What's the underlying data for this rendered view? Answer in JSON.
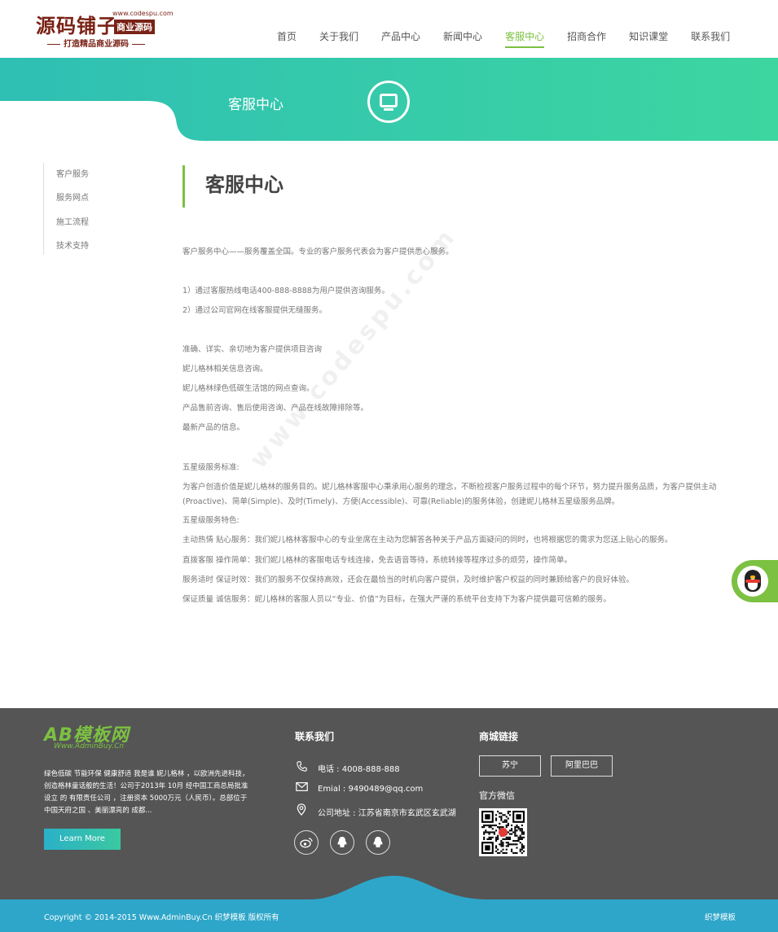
{
  "header": {
    "logo_main": "源码铺子",
    "logo_url": "www.codespu.com",
    "logo_badge": "商业源码",
    "logo_slogan": "打造精品商业源码",
    "nav": [
      {
        "label": "首页"
      },
      {
        "label": "关于我们"
      },
      {
        "label": "产品中心"
      },
      {
        "label": "新闻中心"
      },
      {
        "label": "客服中心"
      },
      {
        "label": "招商合作"
      },
      {
        "label": "知识课堂"
      },
      {
        "label": "联系我们"
      }
    ],
    "active_nav": "客服中心",
    "accent_color": "#7cc142"
  },
  "banner": {
    "title": "客服中心",
    "icon": "monitor-icon",
    "gradient": [
      "#2fbfb4",
      "#3dd6a0"
    ]
  },
  "sidebar": {
    "items": [
      {
        "label": "客户服务"
      },
      {
        "label": "服务网点"
      },
      {
        "label": "施工流程"
      },
      {
        "label": "技术支持"
      }
    ]
  },
  "content": {
    "title": "客服中心",
    "p1": "客户服务中心——服务覆盖全国。专业的客户服务代表会为客户提供悉心服务。",
    "p2": "1）通过客服热线电话400-888-8888为用户提供咨询服务。",
    "p3": "2）通过公司官网在线客服提供无缝服务。",
    "p4": "准确、详实、亲切地为客户提供项目咨询",
    "p5": "妮儿格林相关信息咨询。",
    "p6": "妮儿格林绿色低碳生活馆的网点查询。",
    "p7": "产品售前咨询、售后使用咨询、产品在线故障排除等。",
    "p8": "最新产品的信息。",
    "p9": "五星级服务标准:",
    "p10": "为客户创造价值是妮儿格林的服务目的。妮儿格林客服中心秉承用心服务的理念，不断检视客户服务过程中的每个环节，努力提升服务品质，为客户提供主动(Proactive)、简单(Simple)、及时(Timely)、方便(Accessible)、可靠(Reliable)的服务体验，创建妮儿格林五星级服务品牌。",
    "p11": "五星级服务特色:",
    "p12": "主动热情 贴心服务：我们妮儿格林客服中心的专业坐席在主动为您解答各种关于产品方面疑问的同时，也将根据您的需求为您送上贴心的服务。",
    "p13": "直拨客服 操作简单：我们妮儿格林的客服电话专线连接，免去语音等待，系统转接等程序过多的烦劳，操作简单。",
    "p14": "服务适时 保证时效：我们的服务不仅保持高效，还会在最恰当的时机向客户提供，及时维护客户权益的同时兼顾给客户的良好体验。",
    "p15": "保证质量 诚信服务：妮儿格林的客服人员以“专业、价值”为目标，在强大严谨的系统平台支持下为客户提供最可信赖的服务。",
    "watermark": "www.codespu.com"
  },
  "float": {
    "icon": "qq-penguin-icon"
  },
  "footer": {
    "logo": "AB模板网",
    "logo_sub": "Www.AdminBuy.Cn",
    "intro": "绿色低碳 节能环保 健康舒适 我是谁 妮儿格林 ，以欧洲先进科技，创造格林童话般的生活！公司于2013年 10月 经中国工商总局批准设立 的 有限责任公司 ，注册资本 5000万元（人民币）。总部位于中国天府之国 、美丽漂亮的 成都...",
    "learn_more": "Learn More",
    "contact_title": "联系我们",
    "phone": "电话 : 4008-888-888",
    "email": "Emial : 9490489@qq.com",
    "address": "公司地址 : 江苏省南京市玄武区玄武湖",
    "social": [
      {
        "icon": "weibo-icon"
      },
      {
        "icon": "qq-icon"
      },
      {
        "icon": "qq-icon"
      }
    ],
    "mall_title": "商城链接",
    "malls": [
      {
        "label": "苏宁"
      },
      {
        "label": "阿里巴巴"
      }
    ],
    "wechat": "官方微信",
    "copyright": "Copyright © 2014-2015 Www.AdminBuy.Cn 织梦模板 版权所有",
    "dede": "织梦模板",
    "bg_color": "#555555",
    "bottom_color": "#2ea6c9"
  }
}
